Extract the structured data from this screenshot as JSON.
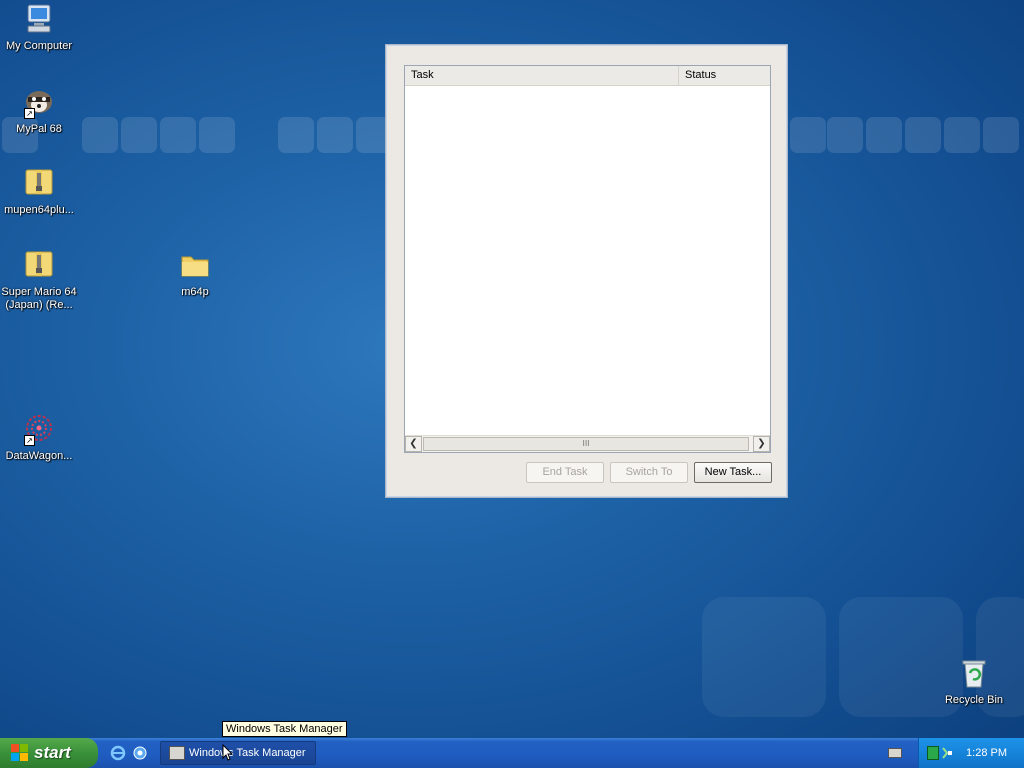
{
  "desktop": {
    "icons": [
      {
        "label": "My Computer",
        "icon": "computer-icon"
      },
      {
        "label": "MyPal 68",
        "icon": "raccoon-icon",
        "shortcut": true
      },
      {
        "label": "mupen64plu...",
        "icon": "zip-folder-icon"
      },
      {
        "label": "Super Mario 64 (Japan) (Re...",
        "icon": "zip-folder-icon"
      },
      {
        "label": "m64p",
        "icon": "folder-icon"
      },
      {
        "label": "DataWagon...",
        "icon": "datawagon-icon",
        "shortcut": true
      },
      {
        "label": "Recycle Bin",
        "icon": "recycle-bin-icon"
      }
    ]
  },
  "task_manager": {
    "columns": {
      "task": "Task",
      "status": "Status"
    },
    "tasks": [],
    "buttons": {
      "end_task": "End Task",
      "switch_to": "Switch To",
      "new_task": "New Task..."
    },
    "scroll_thumb_grip": "III"
  },
  "taskbar": {
    "start_label": "start",
    "quick_launch": [
      "internet-explorer-icon",
      "show-desktop-icon"
    ],
    "task_buttons": [
      {
        "label": "Windows Task Manager",
        "icon": "task-manager-icon"
      }
    ],
    "clock": "1:28 PM"
  },
  "tooltip": {
    "text": "Windows Task Manager"
  },
  "colors": {
    "desktop_bg": "#1e62a6",
    "taskbar": "#2261c4",
    "start_button": "#3a913a",
    "tray": "#1684da"
  }
}
